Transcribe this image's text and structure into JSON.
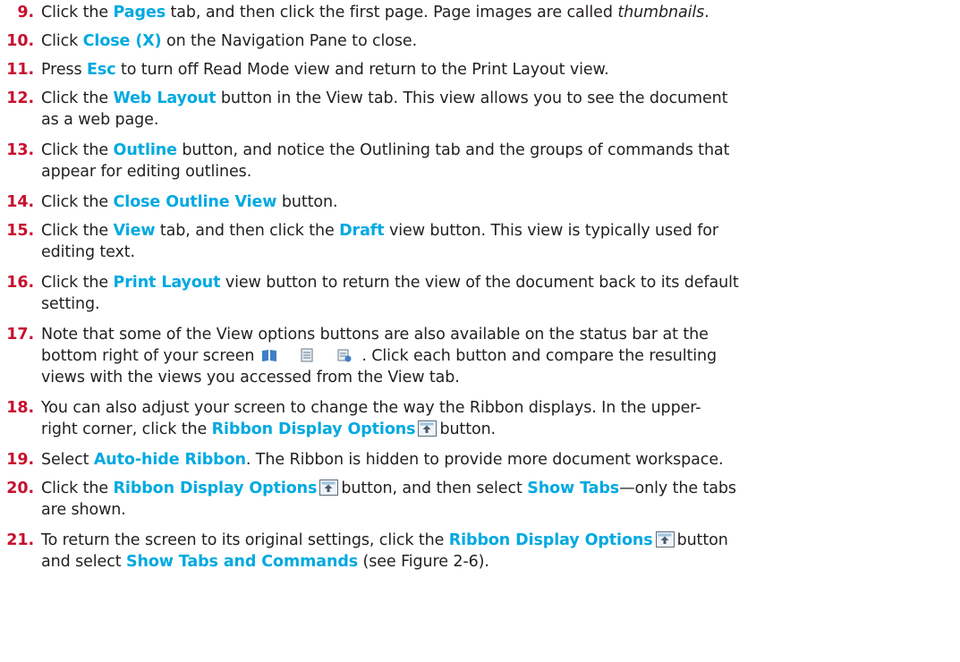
{
  "steps": [
    {
      "num": "9.",
      "lines": [
        [
          {
            "t": "Click the "
          },
          {
            "t": "Pages",
            "k": 1
          },
          {
            "t": " tab, and then click the first page. Page images are called "
          },
          {
            "t": "thumbnails",
            "i": 1
          },
          {
            "t": "."
          }
        ]
      ]
    },
    {
      "num": "10.",
      "lines": [
        [
          {
            "t": "Click "
          },
          {
            "t": "Close (X)",
            "k": 1
          },
          {
            "t": " on the Navigation Pane to close."
          }
        ]
      ]
    },
    {
      "num": "11.",
      "lines": [
        [
          {
            "t": "Press "
          },
          {
            "t": "Esc",
            "k": 1
          },
          {
            "t": " to turn off Read Mode view and return to the Print Layout view."
          }
        ]
      ]
    },
    {
      "num": "12.",
      "lines": [
        [
          {
            "t": "Click the "
          },
          {
            "t": "Web Layout",
            "k": 1
          },
          {
            "t": " button in the View tab. This view allows you to see the document"
          }
        ],
        [
          {
            "t": "as a web page."
          }
        ]
      ]
    },
    {
      "num": "13.",
      "lines": [
        [
          {
            "t": "Click the "
          },
          {
            "t": "Outline",
            "k": 1
          },
          {
            "t": " button, and notice the Outlining tab and the groups of commands that"
          }
        ],
        [
          {
            "t": "appear for editing outlines."
          }
        ]
      ]
    },
    {
      "num": "14.",
      "lines": [
        [
          {
            "t": "Click the "
          },
          {
            "t": "Close Outline View",
            "k": 1
          },
          {
            "t": " button."
          }
        ]
      ]
    },
    {
      "num": "15.",
      "lines": [
        [
          {
            "t": "Click the "
          },
          {
            "t": "View",
            "k": 1
          },
          {
            "t": " tab, and then click the "
          },
          {
            "t": "Draft",
            "k": 1
          },
          {
            "t": " view button. This view is typically used for"
          }
        ],
        [
          {
            "t": "editing text."
          }
        ]
      ]
    },
    {
      "num": "16.",
      "lines": [
        [
          {
            "t": "Click the "
          },
          {
            "t": "Print Layout",
            "k": 1
          },
          {
            "t": " view button to return the view of the document back to its default"
          }
        ],
        [
          {
            "t": "setting."
          }
        ]
      ]
    },
    {
      "num": "17.",
      "lines": [
        [
          {
            "t": "Note that some of the View options buttons are also available on the status bar at the"
          }
        ],
        [
          {
            "t": "bottom right of your screen"
          },
          {
            "icon": "view-buttons"
          },
          {
            "t": ". Click each button and compare the resulting"
          }
        ],
        [
          {
            "t": "views with the views you accessed from the View tab."
          }
        ]
      ]
    },
    {
      "num": "18.",
      "lines": [
        [
          {
            "t": "You can also adjust your screen to change the way the Ribbon displays. In the upper-"
          }
        ],
        [
          {
            "t": "right corner, click the "
          },
          {
            "t": "Ribbon Display Options",
            "k": 1
          },
          {
            "icon": "ribbon"
          },
          {
            "t": "button."
          }
        ]
      ]
    },
    {
      "num": "19.",
      "lines": [
        [
          {
            "t": "Select "
          },
          {
            "t": "Auto-hide Ribbon",
            "k": 1
          },
          {
            "t": ". The Ribbon is hidden to provide more document workspace."
          }
        ]
      ]
    },
    {
      "num": "20.",
      "lines": [
        [
          {
            "t": "Click the "
          },
          {
            "t": "Ribbon Display Options",
            "k": 1
          },
          {
            "icon": "ribbon"
          },
          {
            "t": "button, and then select "
          },
          {
            "t": "Show Tabs",
            "k": 1
          },
          {
            "t": "—only the tabs"
          }
        ],
        [
          {
            "t": "are shown."
          }
        ]
      ]
    },
    {
      "num": "21.",
      "lines": [
        [
          {
            "t": "To return the screen to its original settings, click the "
          },
          {
            "t": "Ribbon Display Options",
            "k": 1
          },
          {
            "icon": "ribbon"
          },
          {
            "t": "button"
          }
        ],
        [
          {
            "t": "and select "
          },
          {
            "t": "Show Tabs and Commands",
            "k": 1
          },
          {
            "t": " (see Figure 2-6)."
          }
        ]
      ]
    }
  ],
  "colors": {
    "number": "#c8102e",
    "keyword": "#00a9e0",
    "text": "#231f20"
  }
}
